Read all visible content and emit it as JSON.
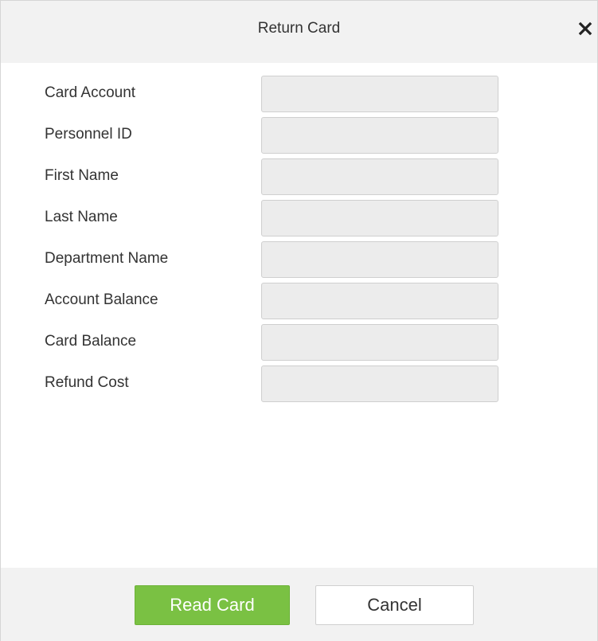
{
  "dialog": {
    "title": "Return Card",
    "close_icon": "close-icon"
  },
  "form": {
    "fields": [
      {
        "label": "Card Account",
        "value": ""
      },
      {
        "label": "Personnel ID",
        "value": ""
      },
      {
        "label": "First Name",
        "value": ""
      },
      {
        "label": "Last Name",
        "value": ""
      },
      {
        "label": "Department Name",
        "value": ""
      },
      {
        "label": "Account Balance",
        "value": ""
      },
      {
        "label": "Card Balance",
        "value": ""
      },
      {
        "label": "Refund Cost",
        "value": ""
      }
    ]
  },
  "footer": {
    "read_card_label": "Read Card",
    "cancel_label": "Cancel"
  },
  "colors": {
    "primary": "#7ac143",
    "header_bg": "#f2f2f2",
    "field_bg": "#ececec"
  }
}
